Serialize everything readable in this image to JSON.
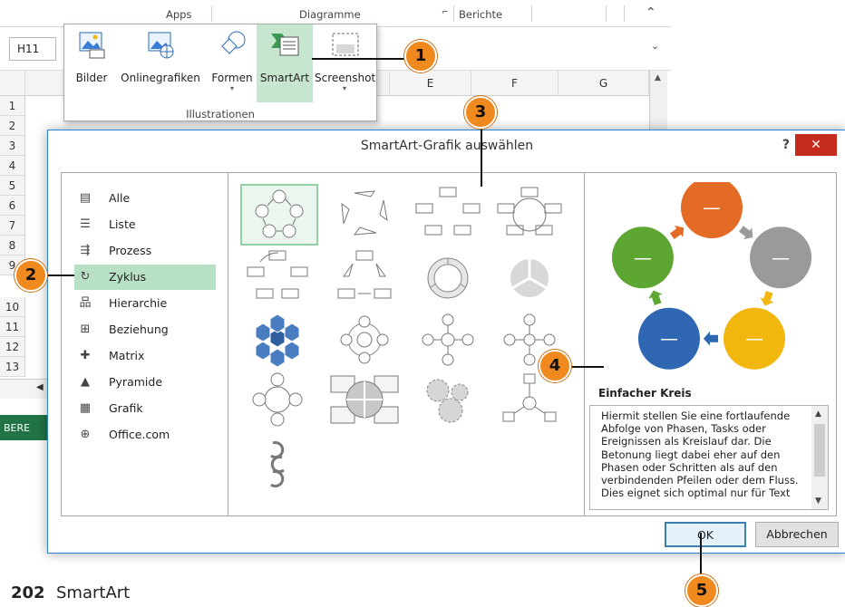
{
  "ribbon": {
    "groups": [
      "Apps",
      "Diagramme",
      "Berichte"
    ],
    "launcher_glyph": "⌐",
    "collapse_glyph": "⌃"
  },
  "namebox": {
    "value": "H11"
  },
  "grid": {
    "columns": [
      "E",
      "F",
      "G"
    ],
    "rows": [
      "1",
      "2",
      "3",
      "4",
      "5",
      "6",
      "7",
      "8",
      "9",
      "10",
      "11",
      "12",
      "13"
    ],
    "status": "BERE"
  },
  "illustrations": {
    "items": [
      {
        "label": "Bilder",
        "icon": "pictures-icon",
        "has_caret": false
      },
      {
        "label": "Onlinegrafiken",
        "icon": "online-pictures-icon",
        "has_caret": false
      },
      {
        "label": "Formen",
        "icon": "shapes-icon",
        "has_caret": true
      },
      {
        "label": "SmartArt",
        "icon": "smartart-icon",
        "has_caret": false
      },
      {
        "label": "Screenshot",
        "icon": "screenshot-icon",
        "has_caret": true
      }
    ],
    "group_label": "Illustrationen",
    "caret": "▾"
  },
  "dialog": {
    "title": "SmartArt-Grafik auswählen",
    "help": "?",
    "close": "✕",
    "categories": [
      {
        "label": "Alle",
        "icon": "all-icon"
      },
      {
        "label": "Liste",
        "icon": "list-icon"
      },
      {
        "label": "Prozess",
        "icon": "process-icon"
      },
      {
        "label": "Zyklus",
        "icon": "cycle-icon",
        "selected": true
      },
      {
        "label": "Hierarchie",
        "icon": "hierarchy-icon"
      },
      {
        "label": "Beziehung",
        "icon": "relationship-icon"
      },
      {
        "label": "Matrix",
        "icon": "matrix-icon"
      },
      {
        "label": "Pyramide",
        "icon": "pyramid-icon"
      },
      {
        "label": "Grafik",
        "icon": "picture-icon"
      },
      {
        "label": "Office.com",
        "icon": "globe-icon"
      }
    ],
    "category_glyphs": [
      "▤",
      "☰",
      "⇶",
      "↻",
      "品",
      "⊞",
      "✚",
      "▲",
      "▦",
      "⊕"
    ],
    "preview": {
      "title": "Einfacher Kreis",
      "description": "Hiermit stellen Sie eine fortlaufende Abfolge von Phasen, Tasks oder Ereignissen als Kreislauf dar. Die Betonung liegt dabei eher auf den Phasen oder Schritten als auf den verbindenden Pfeilen oder dem Fluss. Dies eignet sich optimal nur für Text",
      "circle_colors": [
        "#e36b26",
        "#9a9a9a",
        "#f2b70f",
        "#2f67b3",
        "#5da632"
      ],
      "circle_label": "—"
    },
    "ok_label": "OK",
    "cancel_label": "Abbrechen"
  },
  "callouts": [
    "1",
    "2",
    "3",
    "4",
    "5"
  ],
  "footer": {
    "page_number": "202",
    "text": "SmartArt"
  },
  "colors": {
    "accent": "#f08a1e",
    "selection": "#b8e0c4",
    "close_red": "#c42b1c"
  }
}
